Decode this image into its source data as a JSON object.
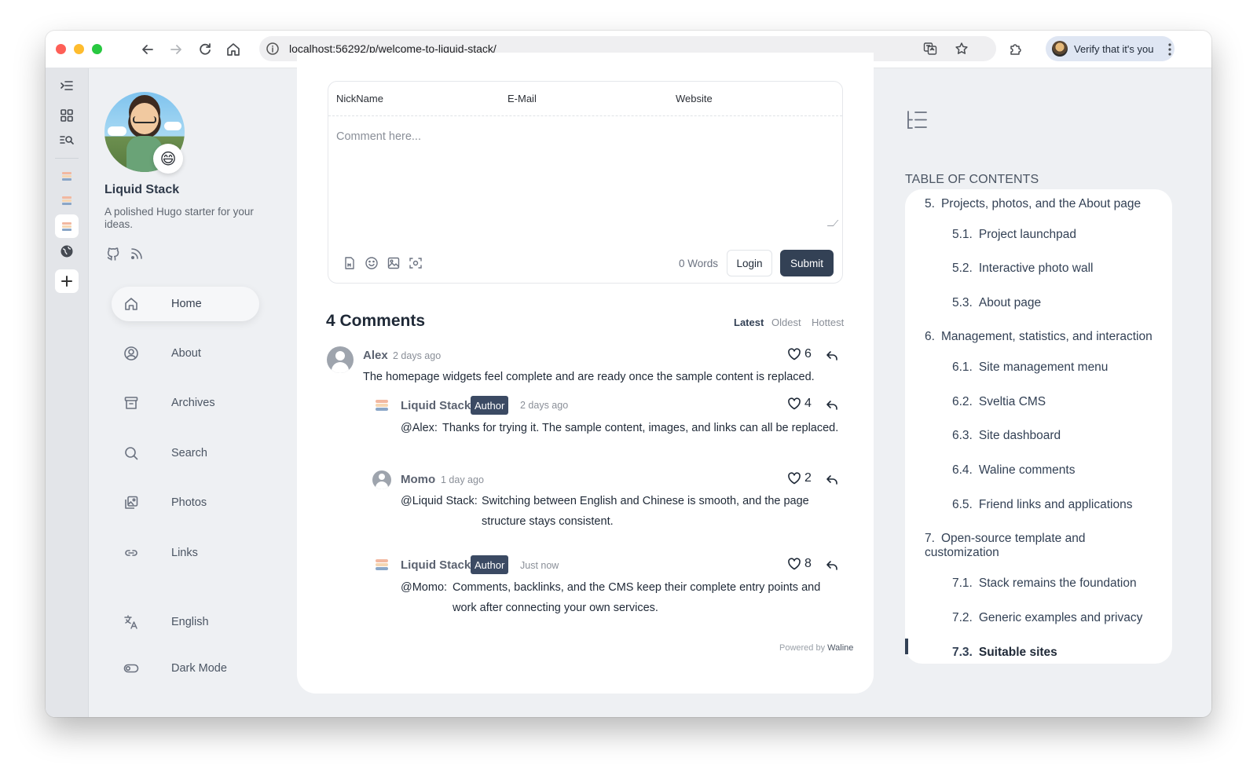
{
  "browser": {
    "url": "localhost:56292/p/welcome-to-liquid-stack/",
    "profile_label": "Verify that it's you"
  },
  "sidebar": {
    "site_name": "Liquid Stack",
    "site_description": "A polished Hugo starter for your ideas.",
    "avatar_emoji": "😄",
    "menu": [
      {
        "label": "Home",
        "icon": "home-icon"
      },
      {
        "label": "About",
        "icon": "user-circle-icon"
      },
      {
        "label": "Archives",
        "icon": "archive-icon"
      },
      {
        "label": "Search",
        "icon": "search-icon"
      },
      {
        "label": "Photos",
        "icon": "photos-icon"
      },
      {
        "label": "Links",
        "icon": "link-icon"
      }
    ],
    "language_label": "English",
    "dark_mode_label": "Dark Mode"
  },
  "comment_form": {
    "nickname_label": "NickName",
    "email_label": "E-Mail",
    "website_label": "Website",
    "textarea_placeholder": "Comment here...",
    "word_count": "0",
    "words_label": "Words",
    "login_label": "Login",
    "submit_label": "Submit"
  },
  "comments": {
    "count_title": "4 Comments",
    "sort_tabs": [
      "Latest",
      "Oldest",
      "Hottest"
    ],
    "active_sort": "Latest",
    "items": [
      {
        "name": "Alex",
        "badge": "",
        "time": "2 days ago",
        "likes": "6",
        "mention": "",
        "text": "The homepage widgets feel complete and are ready once the sample content is replaced."
      },
      {
        "name": "Liquid Stack",
        "badge": "Author",
        "time": "2 days ago",
        "likes": "4",
        "mention": "@Alex:",
        "text": "Thanks for trying it. The sample content, images, and links can all be replaced."
      },
      {
        "name": "Momo",
        "badge": "",
        "time": "1 day ago",
        "likes": "2",
        "mention": "@Liquid Stack:",
        "text_line1": "Switching between English and Chinese is smooth, and the page",
        "text_line2": "structure stays consistent."
      },
      {
        "name": "Liquid Stack",
        "badge": "Author",
        "time": "Just now",
        "likes": "8",
        "mention": "@Momo:",
        "text_line1": "Comments, backlinks, and the CMS keep their complete entry points and",
        "text_line2": "work after connecting your own services."
      }
    ],
    "powered_by_prefix": "Powered by",
    "powered_by_name": "Waline"
  },
  "toc": {
    "title": "TABLE OF CONTENTS",
    "items": [
      {
        "num": "5.",
        "label": "Projects, photos, and the About page"
      },
      {
        "num": "5.1.",
        "label": "Project launchpad"
      },
      {
        "num": "5.2.",
        "label": "Interactive photo wall"
      },
      {
        "num": "5.3.",
        "label": "About page"
      },
      {
        "num": "6.",
        "label": "Management, statistics, and interaction"
      },
      {
        "num": "6.1.",
        "label": "Site management menu"
      },
      {
        "num": "6.2.",
        "label": "Sveltia CMS"
      },
      {
        "num": "6.3.",
        "label": "Site dashboard"
      },
      {
        "num": "6.4.",
        "label": "Waline comments"
      },
      {
        "num": "6.5.",
        "label": "Friend links and applications"
      },
      {
        "num": "7.",
        "label_line1": "Open-source template and",
        "label_line2": "customization"
      },
      {
        "num": "7.1.",
        "label": "Stack remains the foundation"
      },
      {
        "num": "7.2.",
        "label": "Generic examples and privacy"
      },
      {
        "num": "7.3.",
        "label": "Suitable sites"
      }
    ],
    "active_item": "7.3."
  },
  "colors": {
    "accent": "#334155",
    "author_badge": "#3b4a63",
    "page_bg": "#eef0f3"
  }
}
